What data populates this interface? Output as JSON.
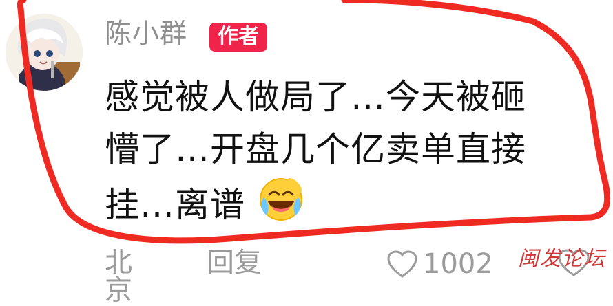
{
  "comment": {
    "username": "陈小群",
    "author_badge": "作者",
    "text_lines": [
      "感觉被人做局了…今天被砸",
      "懵了…开盘几个亿卖单直接",
      "挂…离谱"
    ],
    "emoji": "laughing-crying-emoji",
    "location": "北京",
    "reply_label": "回复",
    "like_count": "1002"
  },
  "watermark": "闽发论坛",
  "colors": {
    "badge": "#f0244a",
    "highlight_stroke": "#ef2a22",
    "text": "#111111",
    "muted": "#8f8f8f"
  },
  "icons": {
    "like": "heart-icon",
    "avatar": "anime-avatar"
  }
}
